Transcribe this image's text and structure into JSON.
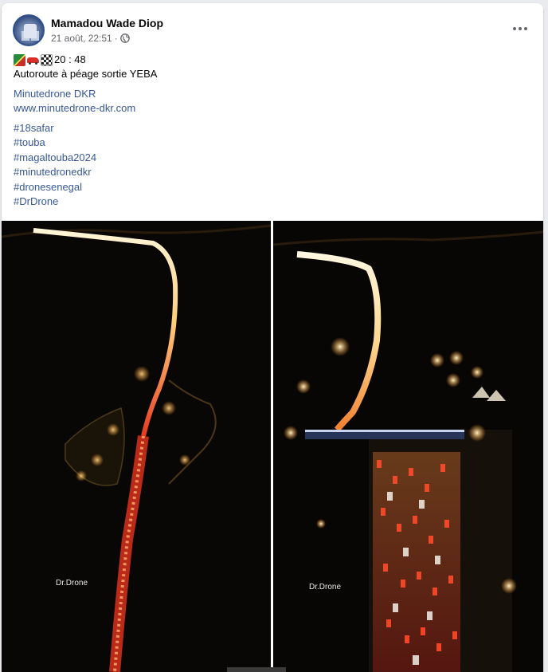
{
  "post": {
    "author": "Mamadou Wade Diop",
    "timestamp": "21 août, 22:51",
    "audience_icon": "globe-icon",
    "separator": "·",
    "emojis": [
      "senegal-flag-icon",
      "red-car-icon",
      "checkered-flag-icon"
    ],
    "time_text": "20 : 48",
    "caption": "Autoroute à péage sortie YEBA",
    "links": [
      "Minutedrone DKR",
      "www.minutedrone-dkr.com"
    ],
    "hashtags": [
      "#18safar",
      "#touba",
      "#magaltouba2024",
      "#minutedronedkr",
      "#dronesenegal",
      "#DrDrone"
    ]
  },
  "photos": [
    {
      "watermark": "Dr.Drone"
    },
    {
      "watermark": "Dr.Drone"
    }
  ],
  "colors": {
    "link": "#385898",
    "meta": "#65676b",
    "photo_bg": "#0a0806"
  }
}
